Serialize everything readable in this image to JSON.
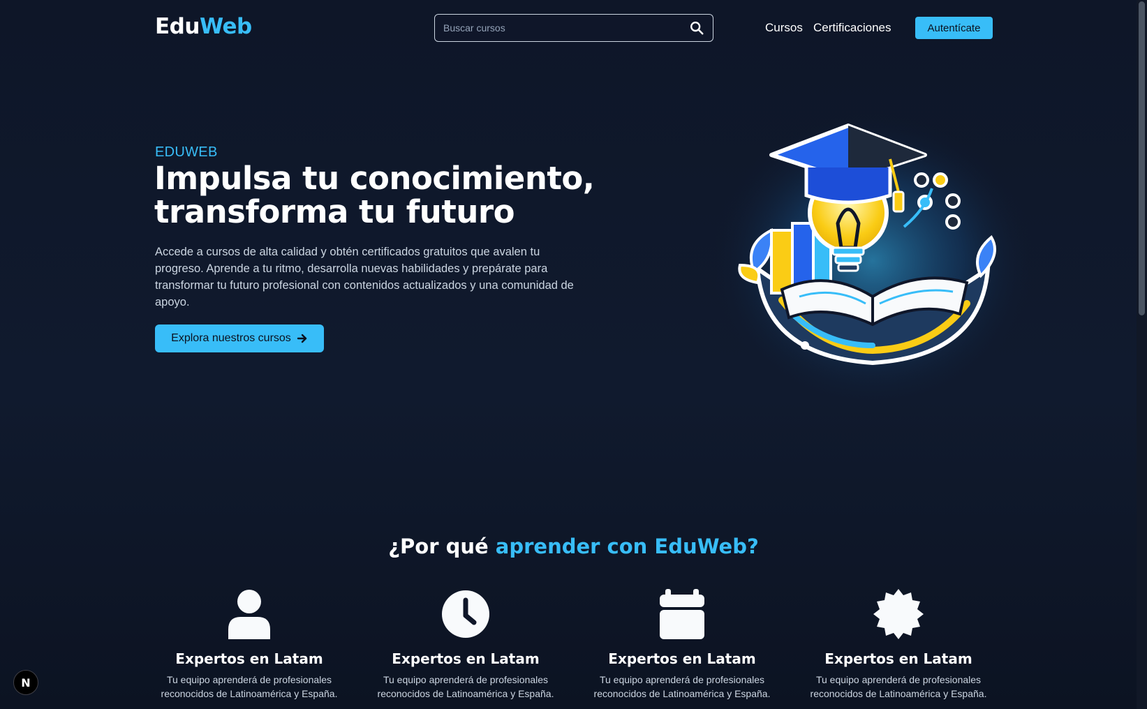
{
  "header": {
    "logo_part1": "Edu",
    "logo_part2": "Web",
    "search_placeholder": "Buscar cursos",
    "nav": [
      "Cursos",
      "Certificaciones"
    ],
    "auth_label": "Autentícate"
  },
  "hero": {
    "eyebrow": "EDUWEB",
    "title_line1": "Impulsa tu conocimiento,",
    "title_line2": "transforma tu futuro",
    "description": "Accede a cursos de alta calidad y obtén certificados gratuitos que avalen tu progreso. Aprende a tu ritmo, desarrolla nuevas habilidades y prepárate para transformar tu futuro profesional con contenidos actualizados y una comunidad de apoyo.",
    "cta_label": "Explora nuestros cursos"
  },
  "why": {
    "title_part1": "¿Por qué ",
    "title_part2": "aprender con EduWeb?",
    "features": [
      {
        "icon": "user-icon",
        "title": "Expertos en Latam",
        "desc": "Tu equipo aprenderá de profesionales reconocidos de Latinoamérica y España."
      },
      {
        "icon": "clock-icon",
        "title": "Expertos en Latam",
        "desc": "Tu equipo aprenderá de profesionales reconocidos de Latinoamérica y España."
      },
      {
        "icon": "calendar-icon",
        "title": "Expertos en Latam",
        "desc": "Tu equipo aprenderá de profesionales reconocidos de Latinoamérica y España."
      },
      {
        "icon": "certificate-icon",
        "title": "Expertos en Latam",
        "desc": "Tu equipo aprenderá de profesionales reconocidos de Latinoamérica y España."
      }
    ]
  },
  "badge": {
    "label": "N"
  },
  "colors": {
    "accent": "#38bdf8",
    "background": "#0f1629",
    "text": "#ffffff"
  }
}
